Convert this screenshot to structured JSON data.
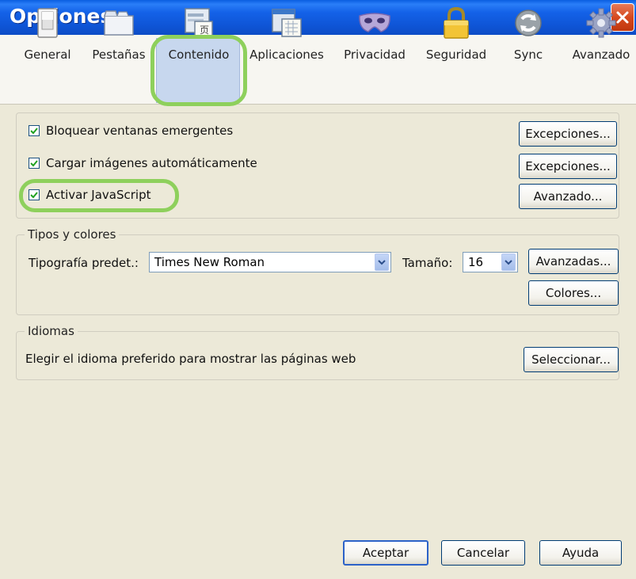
{
  "window": {
    "title": "Opciones"
  },
  "toolbar": {
    "items": [
      {
        "label": "General",
        "icon": "switch-icon"
      },
      {
        "label": "Pestañas",
        "icon": "tabs-icon"
      },
      {
        "label": "Contenido",
        "icon": "content-icon",
        "selected": true
      },
      {
        "label": "Aplicaciones",
        "icon": "applications-icon"
      },
      {
        "label": "Privacidad",
        "icon": "mask-icon"
      },
      {
        "label": "Seguridad",
        "icon": "lock-icon"
      },
      {
        "label": "Sync",
        "icon": "sync-icon"
      },
      {
        "label": "Avanzado",
        "icon": "gear-icon"
      }
    ]
  },
  "content": {
    "popups": {
      "label": "Bloquear ventanas emergentes",
      "checked": true,
      "button": "Excepciones..."
    },
    "images": {
      "label": "Cargar imágenes automáticamente",
      "checked": true,
      "button": "Excepciones..."
    },
    "javascript": {
      "label": "Activar JavaScript",
      "checked": true,
      "button": "Avanzado..."
    }
  },
  "fonts": {
    "legend": "Tipos y colores",
    "default_font_label": "Tipografía predet.:",
    "default_font_value": "Times New Roman",
    "size_label": "Tamaño:",
    "size_value": "16",
    "advanced_button": "Avanzadas...",
    "colors_button": "Colores..."
  },
  "languages": {
    "legend": "Idiomas",
    "description": "Elegir el idioma preferido para mostrar las páginas web",
    "select_button": "Seleccionar..."
  },
  "footer": {
    "ok": "Aceptar",
    "cancel": "Cancelar",
    "help": "Ayuda"
  },
  "colors": {
    "titlebar": "#0d56d8",
    "highlight_ring": "#8ed05c",
    "selected_tab": "#c7d7ee",
    "dialog_bg": "#ece9d8"
  }
}
